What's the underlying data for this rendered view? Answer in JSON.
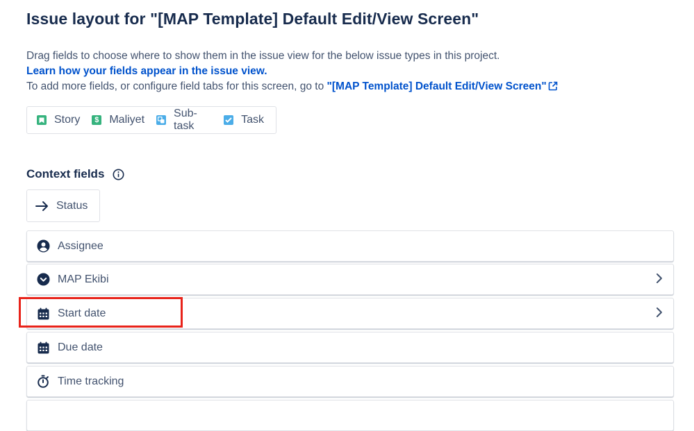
{
  "page": {
    "title": "Issue layout for \"[MAP Template] Default Edit/View Screen\"",
    "description_line1": "Drag fields to choose where to show them in the issue view for the below issue types in this project.",
    "learn_link": "Learn how your fields appear in the issue view.",
    "description_line3_prefix": "To add more fields, or configure field tabs for this screen, go to ",
    "screen_link": "\"[MAP Template] Default Edit/View Screen\""
  },
  "issue_types": [
    {
      "label": "Story",
      "icon": "story-icon",
      "color": "#36b37e"
    },
    {
      "label": "Maliyet",
      "icon": "dollar-icon",
      "color": "#36b37e"
    },
    {
      "label": "Sub-task",
      "icon": "subtask-icon",
      "color": "#4bade8"
    },
    {
      "label": "Task",
      "icon": "checkbox-icon",
      "color": "#4bade8"
    }
  ],
  "context_fields": {
    "title": "Context fields",
    "status_label": "Status",
    "fields": [
      {
        "label": "Assignee",
        "icon": "user-avatar-icon"
      },
      {
        "label": "MAP Ekibi",
        "icon": "dropdown-circle-icon"
      },
      {
        "label": "Start date",
        "icon": "calendar-icon"
      },
      {
        "label": "Due date",
        "icon": "calendar-icon"
      },
      {
        "label": "Time tracking",
        "icon": "stopwatch-icon"
      }
    ]
  },
  "colors": {
    "text_primary": "#172b4d",
    "text_secondary": "#42526e",
    "link": "#0052cc",
    "highlight": "#e8231a",
    "border": "#dfe1e6"
  }
}
